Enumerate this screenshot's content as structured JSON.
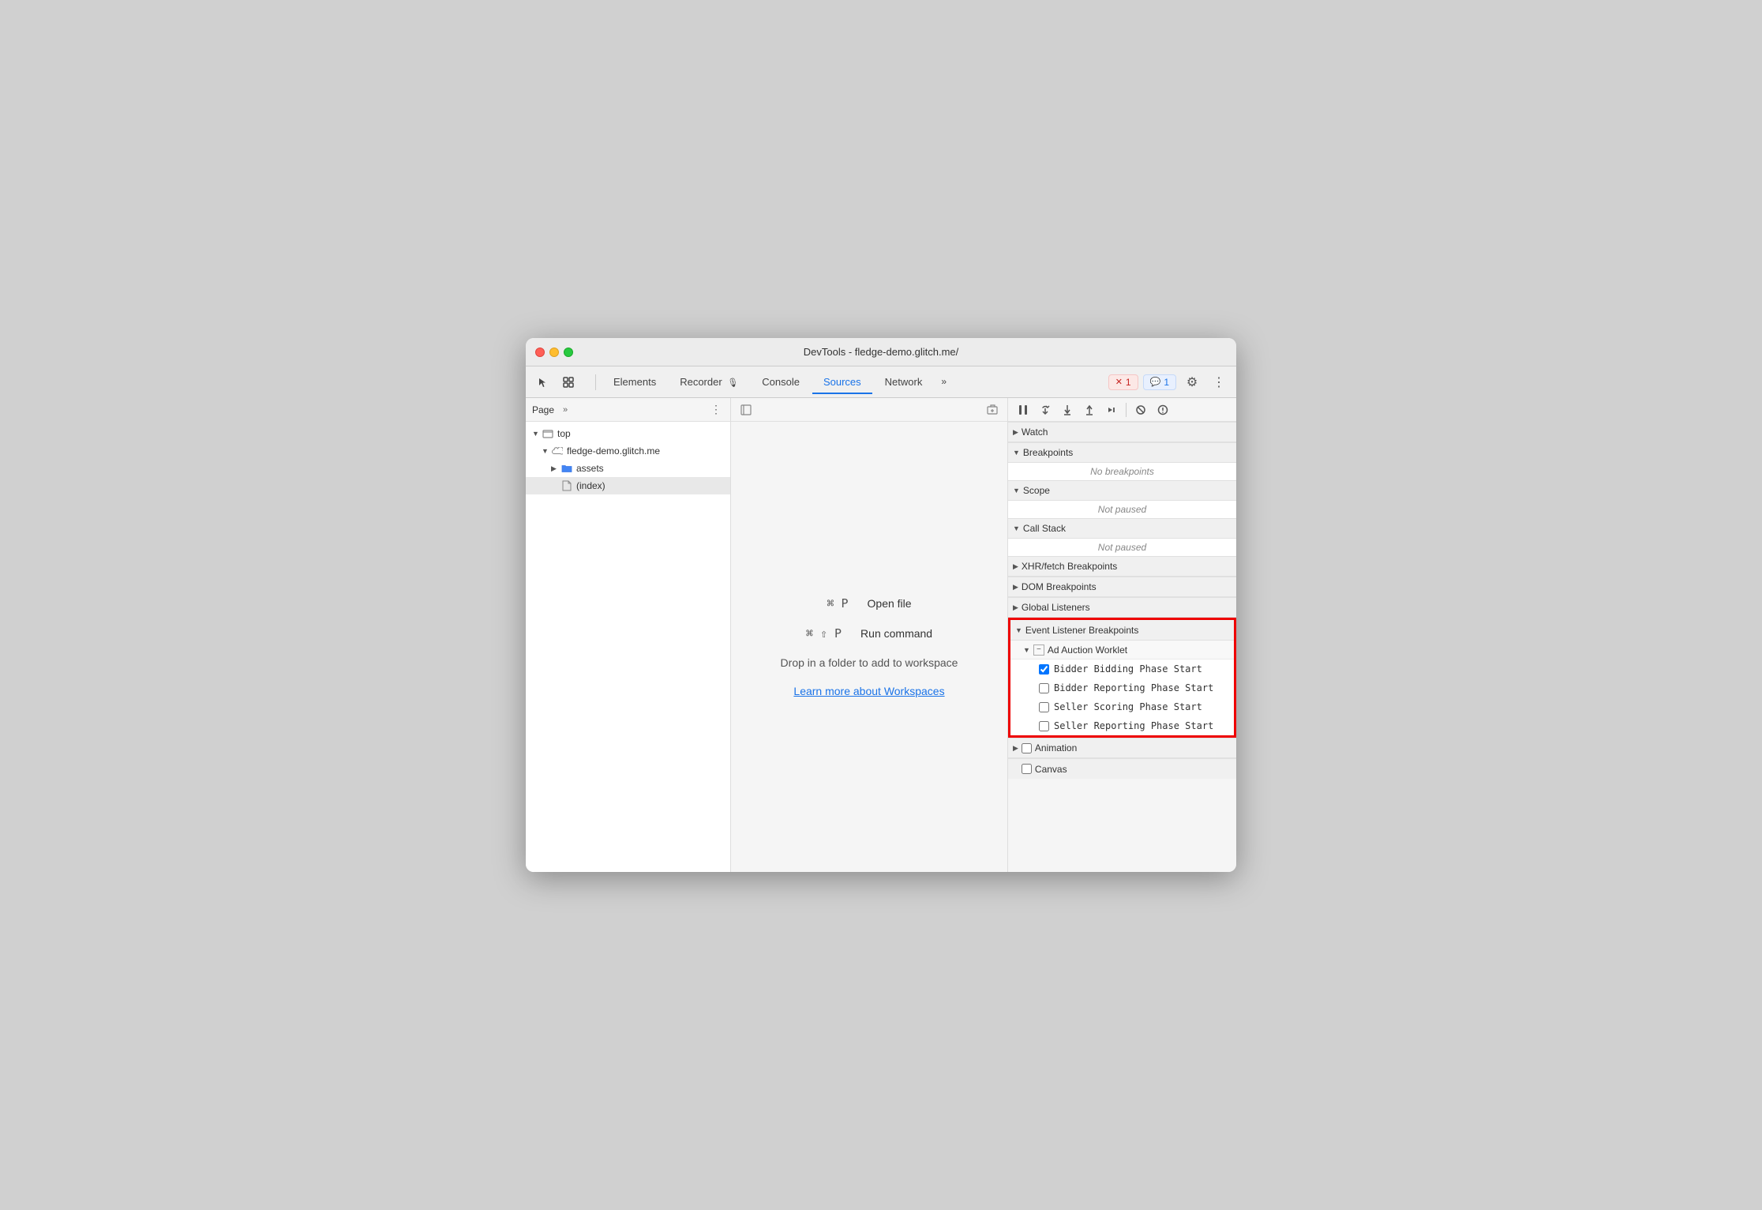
{
  "window": {
    "title": "DevTools - fledge-demo.glitch.me/"
  },
  "toolbar": {
    "tabs": [
      {
        "label": "Elements",
        "active": false
      },
      {
        "label": "Recorder",
        "active": false
      },
      {
        "label": "Console",
        "active": false
      },
      {
        "label": "Sources",
        "active": true
      },
      {
        "label": "Network",
        "active": false
      }
    ],
    "more_tabs": "»",
    "error_badge": "1",
    "info_badge": "1"
  },
  "left_panel": {
    "header_label": "Page",
    "more_icon": "»",
    "dots": "⋮",
    "tree": [
      {
        "level": 0,
        "arrow": "▼",
        "icon": "folder-empty",
        "label": "top"
      },
      {
        "level": 1,
        "arrow": "▼",
        "icon": "cloud",
        "label": "fledge-demo.glitch.me"
      },
      {
        "level": 2,
        "arrow": "▶",
        "icon": "folder",
        "label": "assets"
      },
      {
        "level": 2,
        "arrow": "",
        "icon": "file",
        "label": "(index)",
        "selected": true
      }
    ]
  },
  "editor": {
    "open_file_shortcut": "⌘ P",
    "open_file_label": "Open file",
    "run_command_shortcut": "⌘ ⇧ P",
    "run_command_label": "Run command",
    "drop_text": "Drop in a folder to add to workspace",
    "workspace_link": "Learn more about Workspaces"
  },
  "right_panel": {
    "sections": [
      {
        "label": "Watch",
        "collapsed": true,
        "type": "collapsed"
      },
      {
        "label": "Breakpoints",
        "collapsed": false,
        "empty_text": "No breakpoints",
        "type": "simple"
      },
      {
        "label": "Scope",
        "collapsed": false,
        "empty_text": "Not paused",
        "type": "simple"
      },
      {
        "label": "Call Stack",
        "collapsed": false,
        "empty_text": "Not paused",
        "type": "simple"
      },
      {
        "label": "XHR/fetch Breakpoints",
        "collapsed": true,
        "type": "collapsed"
      },
      {
        "label": "DOM Breakpoints",
        "collapsed": true,
        "type": "collapsed"
      },
      {
        "label": "Global Listeners",
        "collapsed": true,
        "type": "collapsed"
      }
    ],
    "event_listener": {
      "label": "Event Listener Breakpoints",
      "subsections": [
        {
          "label": "Ad Auction Worklet",
          "items": [
            {
              "label": "Bidder Bidding Phase Start",
              "checked": true
            },
            {
              "label": "Bidder Reporting Phase Start",
              "checked": false
            },
            {
              "label": "Seller Scoring Phase Start",
              "checked": false
            },
            {
              "label": "Seller Reporting Phase Start",
              "checked": false
            }
          ]
        }
      ]
    },
    "animation_label": "Animation",
    "canvas_label": "Canvas"
  },
  "debug_buttons": {
    "pause": "⏸",
    "step_over": "↪",
    "step_into": "↓",
    "step_out": "↑",
    "step": "→",
    "deactivate": "⛌",
    "dont_pause": "⏭"
  },
  "colors": {
    "active_tab": "#1a73e8",
    "error_red": "#e00000",
    "link_blue": "#1a73e8"
  }
}
